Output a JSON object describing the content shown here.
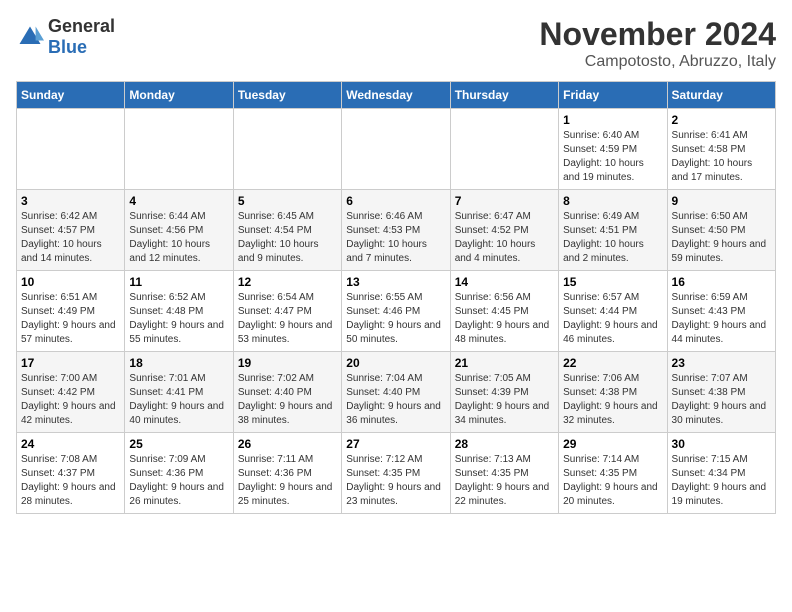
{
  "header": {
    "logo_general": "General",
    "logo_blue": "Blue",
    "month": "November 2024",
    "location": "Campotosto, Abruzzo, Italy"
  },
  "days_of_week": [
    "Sunday",
    "Monday",
    "Tuesday",
    "Wednesday",
    "Thursday",
    "Friday",
    "Saturday"
  ],
  "weeks": [
    [
      {
        "day": "",
        "info": ""
      },
      {
        "day": "",
        "info": ""
      },
      {
        "day": "",
        "info": ""
      },
      {
        "day": "",
        "info": ""
      },
      {
        "day": "",
        "info": ""
      },
      {
        "day": "1",
        "info": "Sunrise: 6:40 AM\nSunset: 4:59 PM\nDaylight: 10 hours and 19 minutes."
      },
      {
        "day": "2",
        "info": "Sunrise: 6:41 AM\nSunset: 4:58 PM\nDaylight: 10 hours and 17 minutes."
      }
    ],
    [
      {
        "day": "3",
        "info": "Sunrise: 6:42 AM\nSunset: 4:57 PM\nDaylight: 10 hours and 14 minutes."
      },
      {
        "day": "4",
        "info": "Sunrise: 6:44 AM\nSunset: 4:56 PM\nDaylight: 10 hours and 12 minutes."
      },
      {
        "day": "5",
        "info": "Sunrise: 6:45 AM\nSunset: 4:54 PM\nDaylight: 10 hours and 9 minutes."
      },
      {
        "day": "6",
        "info": "Sunrise: 6:46 AM\nSunset: 4:53 PM\nDaylight: 10 hours and 7 minutes."
      },
      {
        "day": "7",
        "info": "Sunrise: 6:47 AM\nSunset: 4:52 PM\nDaylight: 10 hours and 4 minutes."
      },
      {
        "day": "8",
        "info": "Sunrise: 6:49 AM\nSunset: 4:51 PM\nDaylight: 10 hours and 2 minutes."
      },
      {
        "day": "9",
        "info": "Sunrise: 6:50 AM\nSunset: 4:50 PM\nDaylight: 9 hours and 59 minutes."
      }
    ],
    [
      {
        "day": "10",
        "info": "Sunrise: 6:51 AM\nSunset: 4:49 PM\nDaylight: 9 hours and 57 minutes."
      },
      {
        "day": "11",
        "info": "Sunrise: 6:52 AM\nSunset: 4:48 PM\nDaylight: 9 hours and 55 minutes."
      },
      {
        "day": "12",
        "info": "Sunrise: 6:54 AM\nSunset: 4:47 PM\nDaylight: 9 hours and 53 minutes."
      },
      {
        "day": "13",
        "info": "Sunrise: 6:55 AM\nSunset: 4:46 PM\nDaylight: 9 hours and 50 minutes."
      },
      {
        "day": "14",
        "info": "Sunrise: 6:56 AM\nSunset: 4:45 PM\nDaylight: 9 hours and 48 minutes."
      },
      {
        "day": "15",
        "info": "Sunrise: 6:57 AM\nSunset: 4:44 PM\nDaylight: 9 hours and 46 minutes."
      },
      {
        "day": "16",
        "info": "Sunrise: 6:59 AM\nSunset: 4:43 PM\nDaylight: 9 hours and 44 minutes."
      }
    ],
    [
      {
        "day": "17",
        "info": "Sunrise: 7:00 AM\nSunset: 4:42 PM\nDaylight: 9 hours and 42 minutes."
      },
      {
        "day": "18",
        "info": "Sunrise: 7:01 AM\nSunset: 4:41 PM\nDaylight: 9 hours and 40 minutes."
      },
      {
        "day": "19",
        "info": "Sunrise: 7:02 AM\nSunset: 4:40 PM\nDaylight: 9 hours and 38 minutes."
      },
      {
        "day": "20",
        "info": "Sunrise: 7:04 AM\nSunset: 4:40 PM\nDaylight: 9 hours and 36 minutes."
      },
      {
        "day": "21",
        "info": "Sunrise: 7:05 AM\nSunset: 4:39 PM\nDaylight: 9 hours and 34 minutes."
      },
      {
        "day": "22",
        "info": "Sunrise: 7:06 AM\nSunset: 4:38 PM\nDaylight: 9 hours and 32 minutes."
      },
      {
        "day": "23",
        "info": "Sunrise: 7:07 AM\nSunset: 4:38 PM\nDaylight: 9 hours and 30 minutes."
      }
    ],
    [
      {
        "day": "24",
        "info": "Sunrise: 7:08 AM\nSunset: 4:37 PM\nDaylight: 9 hours and 28 minutes."
      },
      {
        "day": "25",
        "info": "Sunrise: 7:09 AM\nSunset: 4:36 PM\nDaylight: 9 hours and 26 minutes."
      },
      {
        "day": "26",
        "info": "Sunrise: 7:11 AM\nSunset: 4:36 PM\nDaylight: 9 hours and 25 minutes."
      },
      {
        "day": "27",
        "info": "Sunrise: 7:12 AM\nSunset: 4:35 PM\nDaylight: 9 hours and 23 minutes."
      },
      {
        "day": "28",
        "info": "Sunrise: 7:13 AM\nSunset: 4:35 PM\nDaylight: 9 hours and 22 minutes."
      },
      {
        "day": "29",
        "info": "Sunrise: 7:14 AM\nSunset: 4:35 PM\nDaylight: 9 hours and 20 minutes."
      },
      {
        "day": "30",
        "info": "Sunrise: 7:15 AM\nSunset: 4:34 PM\nDaylight: 9 hours and 19 minutes."
      }
    ]
  ]
}
